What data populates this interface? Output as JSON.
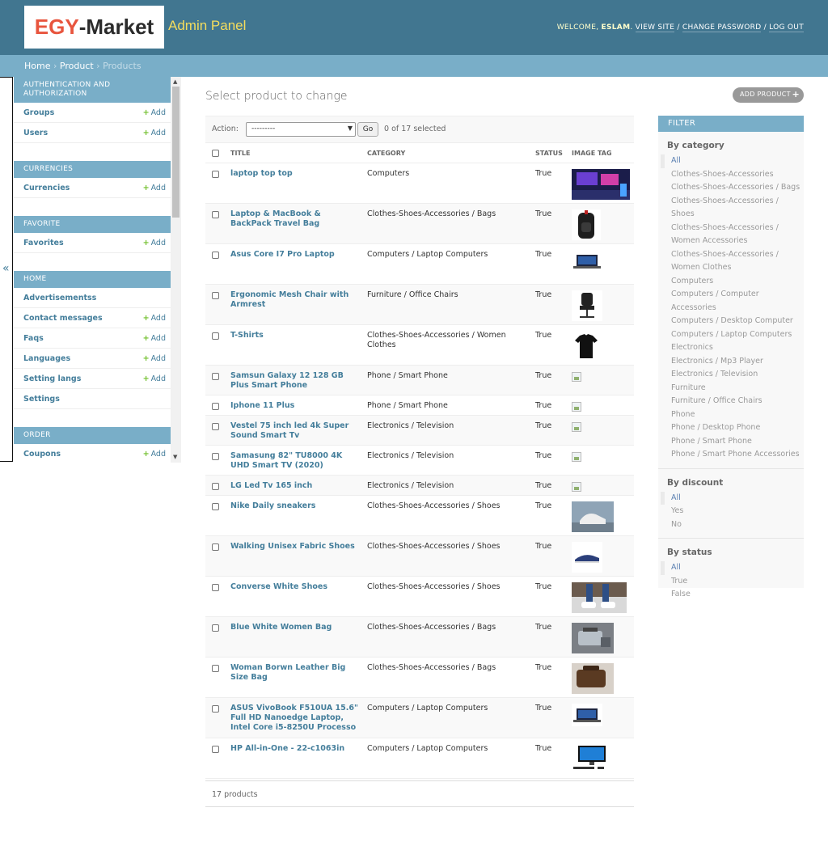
{
  "branding": {
    "logo_part1": "EGY",
    "logo_part2": "-Market",
    "title": "Admin Panel"
  },
  "user_tools": {
    "welcome": "WELCOME,",
    "username": "ESLAM",
    "view_site": "VIEW SITE",
    "change_password": "CHANGE PASSWORD",
    "log_out": "LOG OUT"
  },
  "breadcrumbs": {
    "home": "Home",
    "app": "Product",
    "current": "Products"
  },
  "sidebar": {
    "toggle": "«",
    "add_label": "Add",
    "modules": [
      {
        "caption": "AUTHENTICATION AND AUTHORIZATION",
        "items": [
          {
            "label": "Groups",
            "add": true
          },
          {
            "label": "Users",
            "add": true
          }
        ]
      },
      {
        "caption": "CURRENCIES",
        "items": [
          {
            "label": "Currencies",
            "add": true
          }
        ]
      },
      {
        "caption": "FAVORITE",
        "items": [
          {
            "label": "Favorites",
            "add": true
          }
        ]
      },
      {
        "caption": "HOME",
        "items": [
          {
            "label": "Advertisementss",
            "add": false
          },
          {
            "label": "Contact messages",
            "add": true
          },
          {
            "label": "Faqs",
            "add": true
          },
          {
            "label": "Languages",
            "add": true
          },
          {
            "label": "Setting langs",
            "add": true
          },
          {
            "label": "Settings",
            "add": false
          }
        ]
      },
      {
        "caption": "ORDER",
        "items": [
          {
            "label": "Coupons",
            "add": true
          }
        ]
      }
    ]
  },
  "main": {
    "heading": "Select product to change",
    "add_button": "ADD PRODUCT",
    "actions": {
      "label": "Action:",
      "select_value": "---------",
      "go": "Go",
      "selected_count": "0 of 17 selected"
    },
    "columns": [
      "TITLE",
      "CATEGORY",
      "STATUS",
      "IMAGE TAG"
    ],
    "rows": [
      {
        "title": "laptop top top",
        "category": "Computers",
        "status": "True",
        "image": "gaming-desk"
      },
      {
        "title": "Laptop & MacBook & BackPack Travel Bag",
        "category": "Clothes-Shoes-Accessories / Bags",
        "status": "True",
        "image": "backpack"
      },
      {
        "title": "Asus Core I7 Pro Laptop",
        "category": "Computers / Laptop Computers",
        "status": "True",
        "image": "laptop"
      },
      {
        "title": "Ergonomic Mesh Chair with Armrest",
        "category": "Furniture / Office Chairs",
        "status": "True",
        "image": "chair"
      },
      {
        "title": "T-Shirts",
        "category": "Clothes-Shoes-Accessories / Women Clothes",
        "status": "True",
        "image": "tshirt"
      },
      {
        "title": "Samsun Galaxy 12 128 GB Plus Smart Phone",
        "category": "Phone / Smart Phone",
        "status": "True",
        "image": "broken"
      },
      {
        "title": "Iphone 11 Plus",
        "category": "Phone / Smart Phone",
        "status": "True",
        "image": "broken"
      },
      {
        "title": "Vestel 75 inch led 4k Super Sound Smart Tv",
        "category": "Electronics / Television",
        "status": "True",
        "image": "broken"
      },
      {
        "title": "Samasung 82\" TU8000 4K UHD Smart TV (2020)",
        "category": "Electronics / Television",
        "status": "True",
        "image": "broken"
      },
      {
        "title": "LG Led Tv 165 inch",
        "category": "Electronics / Television",
        "status": "True",
        "image": "broken"
      },
      {
        "title": "Nike Daily sneakers",
        "category": "Clothes-Shoes-Accessories / Shoes",
        "status": "True",
        "image": "sneakers"
      },
      {
        "title": "Walking Unisex Fabric Shoes",
        "category": "Clothes-Shoes-Accessories / Shoes",
        "status": "True",
        "image": "fabric-shoe"
      },
      {
        "title": "Converse White Shoes",
        "category": "Clothes-Shoes-Accessories / Shoes",
        "status": "True",
        "image": "converse"
      },
      {
        "title": "Blue White Women Bag",
        "category": "Clothes-Shoes-Accessories / Bags",
        "status": "True",
        "image": "bag-grey"
      },
      {
        "title": "Woman Borwn Leather Big Size Bag",
        "category": "Clothes-Shoes-Accessories / Bags",
        "status": "True",
        "image": "bag-brown"
      },
      {
        "title": "ASUS VivoBook F510UA 15.6\" Full HD Nanoedge Laptop, Intel Core i5-8250U Processo",
        "category": "Computers / Laptop Computers",
        "status": "True",
        "image": "laptop"
      },
      {
        "title": "HP All-in-One - 22-c1063in",
        "category": "Computers / Laptop Computers",
        "status": "True",
        "image": "aio"
      }
    ],
    "paginator": "17 products"
  },
  "filter": {
    "title": "FILTER",
    "sections": [
      {
        "title": "By category",
        "options": [
          "All",
          "Clothes-Shoes-Accessories",
          "Clothes-Shoes-Accessories / Bags",
          "Clothes-Shoes-Accessories / Shoes",
          "Clothes-Shoes-Accessories / Women Accessories",
          "Clothes-Shoes-Accessories / Women Clothes",
          "Computers",
          "Computers / Computer Accessories",
          "Computers / Desktop Computer",
          "Computers / Laptop Computers",
          "Electronics",
          "Electronics / Mp3 Player",
          "Electronics / Television",
          "Furniture",
          "Furniture / Office Chairs",
          "Phone",
          "Phone / Desktop Phone",
          "Phone / Smart Phone",
          "Phone / Smart Phone Accessories"
        ],
        "selected": 0
      },
      {
        "title": "By discount",
        "options": [
          "All",
          "Yes",
          "No"
        ],
        "selected": 0
      },
      {
        "title": "By status",
        "options": [
          "All",
          "True",
          "False"
        ],
        "selected": 0
      }
    ]
  },
  "colors": {
    "header": "#417690",
    "breadcrumb": "#79aec8",
    "link": "#447e9b",
    "brand_title": "#f5dd5d",
    "add_plus": "#70bf2b"
  }
}
